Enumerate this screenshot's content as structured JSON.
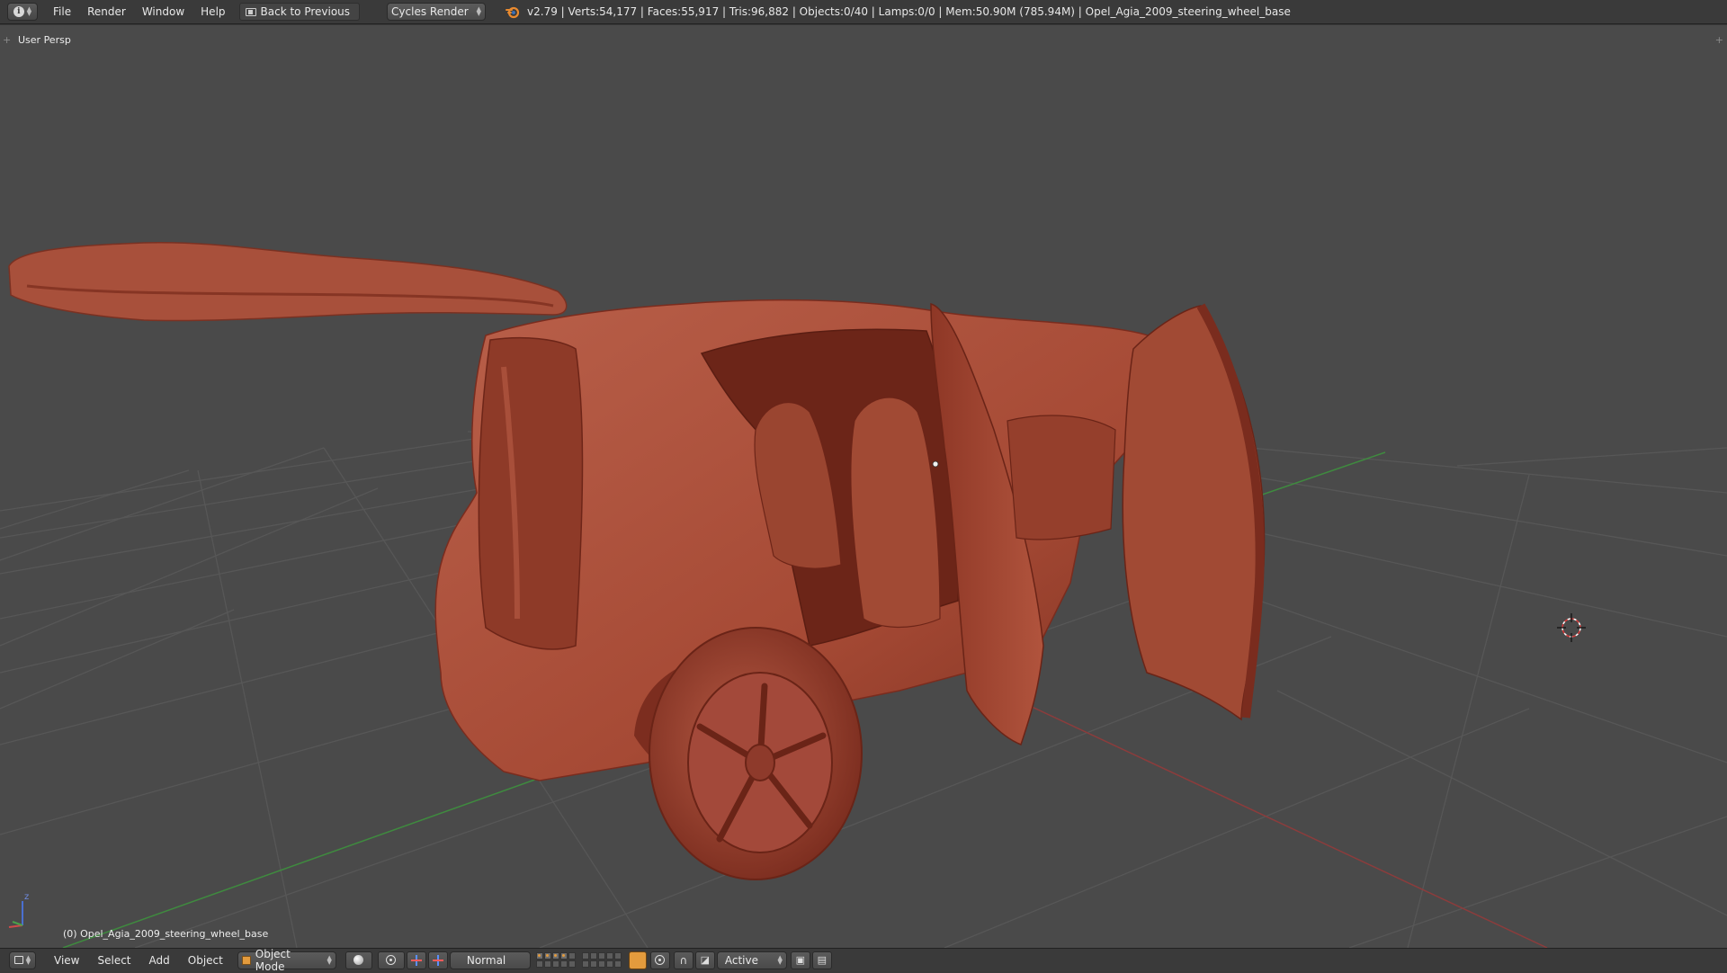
{
  "topbar": {
    "editor_icon": "info-icon",
    "menus": [
      "File",
      "Render",
      "Window",
      "Help"
    ],
    "back_button": "Back to Previous",
    "render_engine": "Cycles Render",
    "stats": "v2.79 | Verts:54,177 | Faces:55,917 | Tris:96,882 | Objects:0/40 | Lamps:0/0 | Mem:50.90M (785.94M) | Opel_Agia_2009_steering_wheel_base"
  },
  "viewport": {
    "view_label": "User Persp",
    "object_label": "(0) Opel_Agia_2009_steering_wheel_base",
    "axis_label": "z",
    "model_color": "#a0442e",
    "background_color": "#4a4a4a",
    "grid_color": "#555555",
    "x_axis_color": "#8c3c3c",
    "y_axis_color": "#3f8a3f"
  },
  "bottombar": {
    "menus": [
      "View",
      "Select",
      "Add",
      "Object"
    ],
    "mode": "Object Mode",
    "orientation": "Normal",
    "snap_target": "Active",
    "accent_color": "#e39b3d"
  }
}
